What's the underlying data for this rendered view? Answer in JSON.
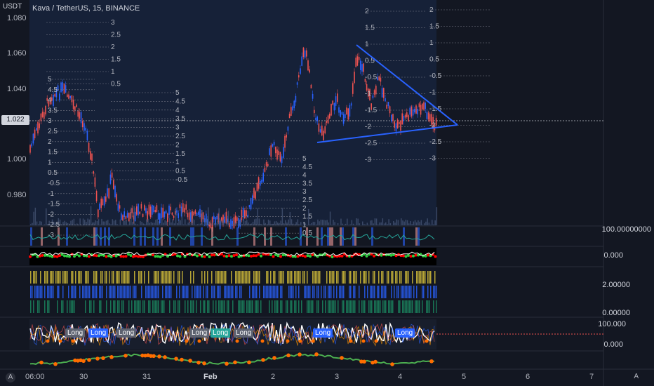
{
  "header": {
    "currency": "USDT",
    "symbol": "Kava / TetherUS, 15, BINANCE"
  },
  "price_axis": {
    "ticks": [
      "1.080",
      "1.060",
      "1.040",
      "1.022",
      "1.000",
      "0.980"
    ],
    "current_price": "1.022"
  },
  "indicator_axes": {
    "pane1": "100.00000000",
    "pane2": "0.000",
    "pane3_top": "2.00000",
    "pane3_bottom": "0.00000",
    "pane4_top": "100.000",
    "pane4_bottom": "0.000"
  },
  "time_axis": {
    "labels": [
      "06:00",
      "30",
      "31",
      "Feb",
      "2",
      "3",
      "4",
      "5",
      "6",
      "7"
    ]
  },
  "fib_levels_left": [
    "3",
    "2.5",
    "2",
    "1.5",
    "1",
    "0.5"
  ],
  "fib_levels_mid": [
    "5",
    "4.5",
    "4",
    "3.5",
    "3",
    "2.5",
    "2",
    "1.5",
    "1",
    "0.5",
    "-0.5"
  ],
  "fib_levels_right_a": [
    "2",
    "1.5",
    "1",
    "0.5",
    "-0.5",
    "-1",
    "-1.5",
    "-2",
    "-2.5",
    "-3"
  ],
  "fib_levels_right_b": [
    "2",
    "1.5",
    "1",
    "0.5",
    "-0.5",
    "-1",
    "-1.5",
    "-2",
    "-2.5",
    "-3"
  ],
  "fib_levels_center": [
    "5",
    "4.5",
    "4",
    "3.5",
    "3",
    "2.5",
    "2",
    "1.5",
    "1",
    "0.5"
  ],
  "fib_levels_far_left": [
    "5",
    "4.5",
    "4",
    "3.5",
    "3",
    "2.5",
    "2",
    "1.5",
    "1",
    "0.5",
    "-0.5",
    "-1",
    "-1.5",
    "-2",
    "-2.5",
    "-3"
  ],
  "signals": {
    "long_label": "Long",
    "long_short": "Long"
  },
  "ui": {
    "timezone_icon": "A",
    "auto_label": "A"
  },
  "colors": {
    "background": "#131722",
    "up_candle": "#2962ff",
    "down_candle": "#ef5350",
    "trendline": "#2962ff",
    "buy": "#26a69a",
    "sell": "#ff0000",
    "volume_yellow": "#c9b437",
    "volume_blue": "#2962ff",
    "volume_green": "#1b8c63"
  }
}
